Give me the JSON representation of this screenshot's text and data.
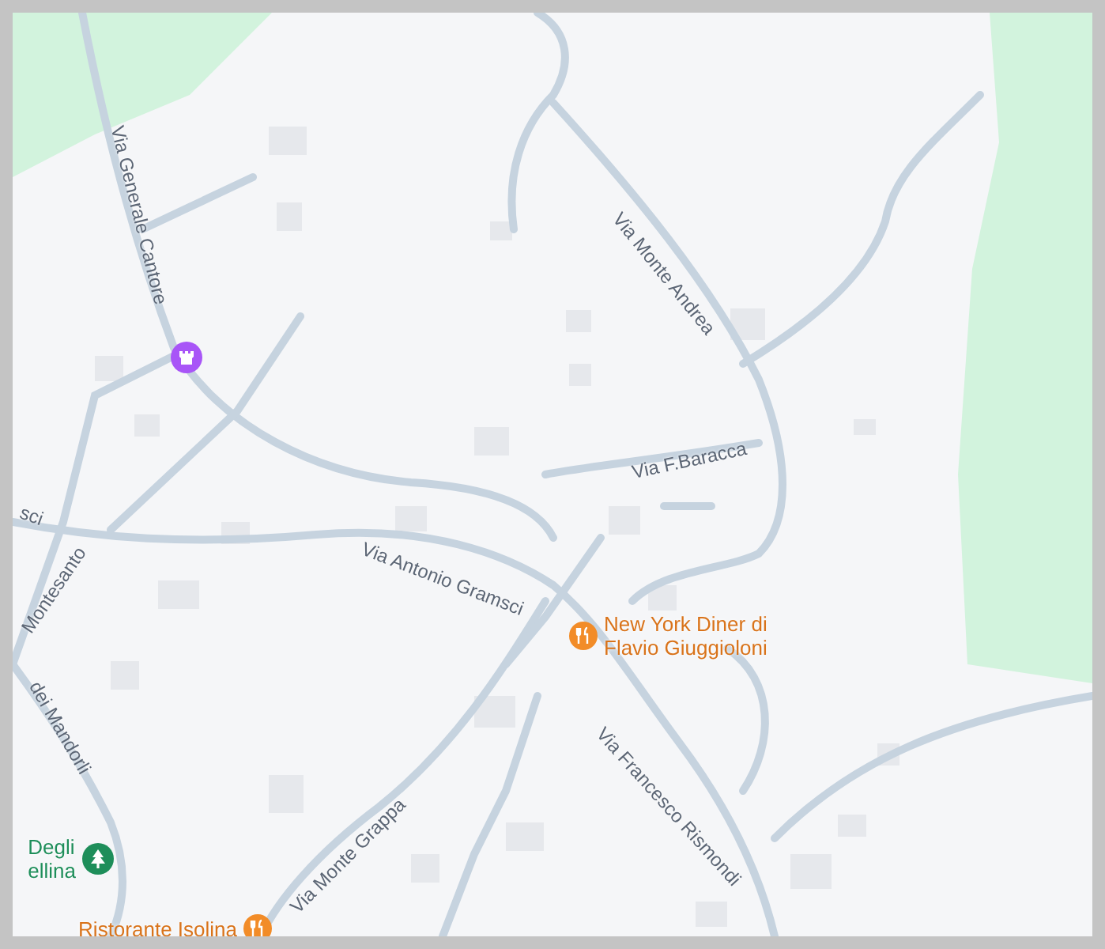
{
  "map": {
    "street_labels": [
      {
        "text": "Via Generale Cantore"
      },
      {
        "text": "Via Monte Andrea"
      },
      {
        "text": "Via F.Baracca"
      },
      {
        "text": "sci"
      },
      {
        "text": "Montesanto"
      },
      {
        "text": "Via Antonio Gramsci"
      },
      {
        "text": "dei Mandorli"
      },
      {
        "text": "Via Francesco Rismondi"
      },
      {
        "text": "Via Monte Grappa"
      }
    ],
    "places": [
      {
        "kind": "landmark"
      },
      {
        "kind": "restaurant",
        "name_lines": [
          "New York Diner di",
          "Flavio Giuggioloni"
        ]
      },
      {
        "kind": "park",
        "name_lines": [
          "Degli",
          "ellina"
        ]
      },
      {
        "kind": "restaurant",
        "name_lines": [
          "Ristorante Isolina"
        ]
      }
    ]
  }
}
